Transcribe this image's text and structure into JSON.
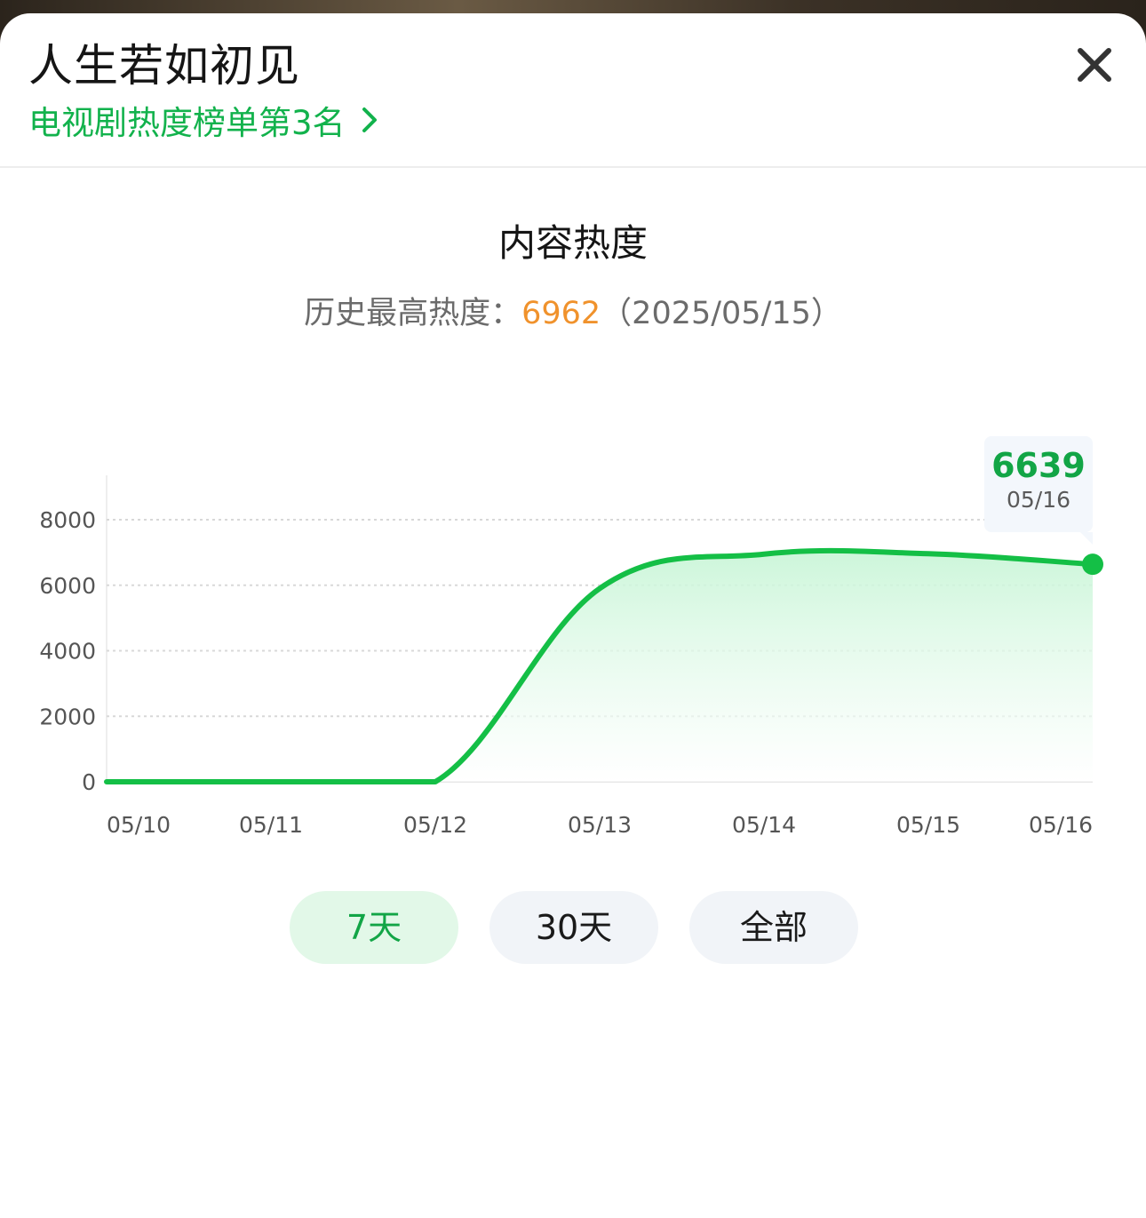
{
  "header": {
    "title": "人生若如初见",
    "rank_label": "电视剧热度榜单第3名",
    "close_icon": "close-icon",
    "chevron_icon": "chevron-right-icon"
  },
  "chart_section": {
    "title": "内容热度",
    "peak_prefix": "历史最高热度：",
    "peak_value": "6962",
    "peak_date": "（2025/05/15）"
  },
  "tooltip": {
    "value": "6639",
    "date": "05/16"
  },
  "colors": {
    "accent_green": "#12b24c",
    "line_green": "#14bf46",
    "peak_orange": "#f0922c",
    "active_tab_bg": "#e2f8e8",
    "inactive_tab_bg": "#f1f4f8"
  },
  "chart_data": {
    "type": "area",
    "categories": [
      "05/10",
      "05/11",
      "05/12",
      "05/13",
      "05/14",
      "05/15",
      "05/16"
    ],
    "x": [
      "05/10",
      "05/11",
      "05/12",
      "05/13",
      "05/14",
      "05/15",
      "05/16"
    ],
    "series": [
      {
        "values": [
          0,
          0,
          0,
          5900,
          6950,
          6962,
          6639
        ]
      }
    ],
    "yticks": [
      0,
      2000,
      4000,
      6000,
      8000
    ],
    "ylim": [
      0,
      8000
    ],
    "grid": true,
    "highlight": {
      "x": "05/16",
      "y": 6639
    }
  },
  "ranges": [
    {
      "label": "7天",
      "active": true
    },
    {
      "label": "30天",
      "active": false
    },
    {
      "label": "全部",
      "active": false
    }
  ]
}
